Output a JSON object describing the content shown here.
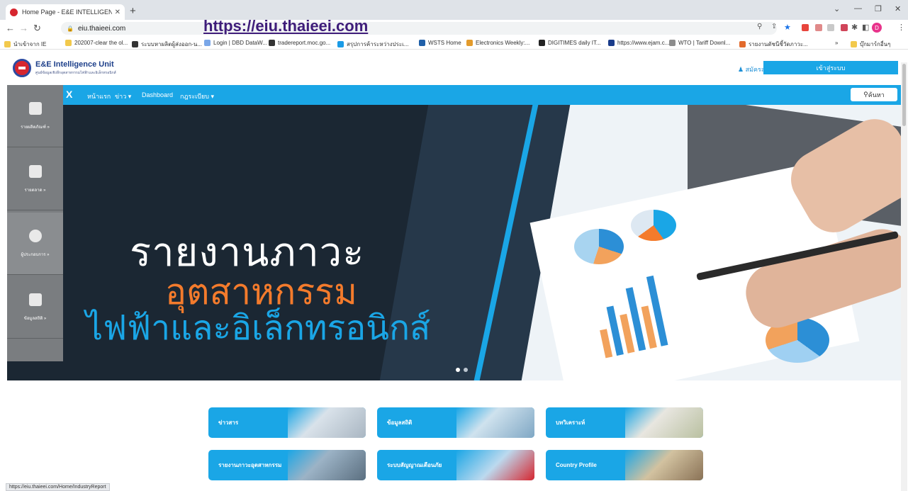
{
  "browser": {
    "tab_title": "Home Page - E&E INTELLIGENCE",
    "url": "eiu.thaieei.com",
    "annotation_url": "https://eiu.thaieei.com",
    "bookmarks": [
      "นำเข้าจาก IE",
      "202007-clear the ol...",
      "ระบบหาผลิตผู้ส่งออก-น...",
      "Login | DBD DataW...",
      "tradereport.moc.go...",
      "สรุปการค้าระหว่างประเ...",
      "WSTS Home",
      "Electronics Weekly:...",
      "DIGITIMES daily IT...",
      "https://www.ejam.c...",
      "WTO | Tariff Downl...",
      "รายงานดัชนีชี้วัดภาวะ...",
      "บุ๊กมาร์กอื่นๆ"
    ],
    "status_url": "https://eiu.thaieei.com/Home/IndustryReport"
  },
  "site": {
    "logo_title": "E&E Intelligence Unit",
    "logo_subtitle": "ศูนย์ข้อมูลเชิงลึกอุตสาหกรรมไฟฟ้าและอิเล็กทรอนิกส์",
    "register": "สมัครสมาชิก",
    "login": "เข้าสู่ระบบ",
    "nav": [
      "X",
      "หน้าแรก",
      "ข่าว",
      "Dashboard",
      "กฎระเบียบ"
    ],
    "search": "ค้นหา"
  },
  "side_menu": [
    {
      "label": "รายผลิตภัณฑ์ »",
      "icon": "box-icon"
    },
    {
      "label": "รายตลาด »",
      "icon": "store-icon"
    },
    {
      "label": "ผู้ประกอบการ »",
      "icon": "person-icon"
    },
    {
      "label": "ข้อมูลสถิติ »",
      "icon": "chart-icon"
    }
  ],
  "hero": {
    "line1": "รายงานภาวะ",
    "line2": "อุตสาหกรรม",
    "line3": "ไฟฟ้าและอิเล็กทรอนิกส์"
  },
  "quick_links": [
    "ข่าวสาร",
    "ข้อมูลสถิติ",
    "บทวิเคราะห์",
    "รายงานภาวะอุตสาหกรรม",
    "ระบบสัญญาณเตือนภัย",
    "Country Profile"
  ],
  "colors": {
    "brand_blue": "#1aa6e6",
    "brand_orange": "#f47b2c",
    "brand_red": "#d6262f"
  }
}
